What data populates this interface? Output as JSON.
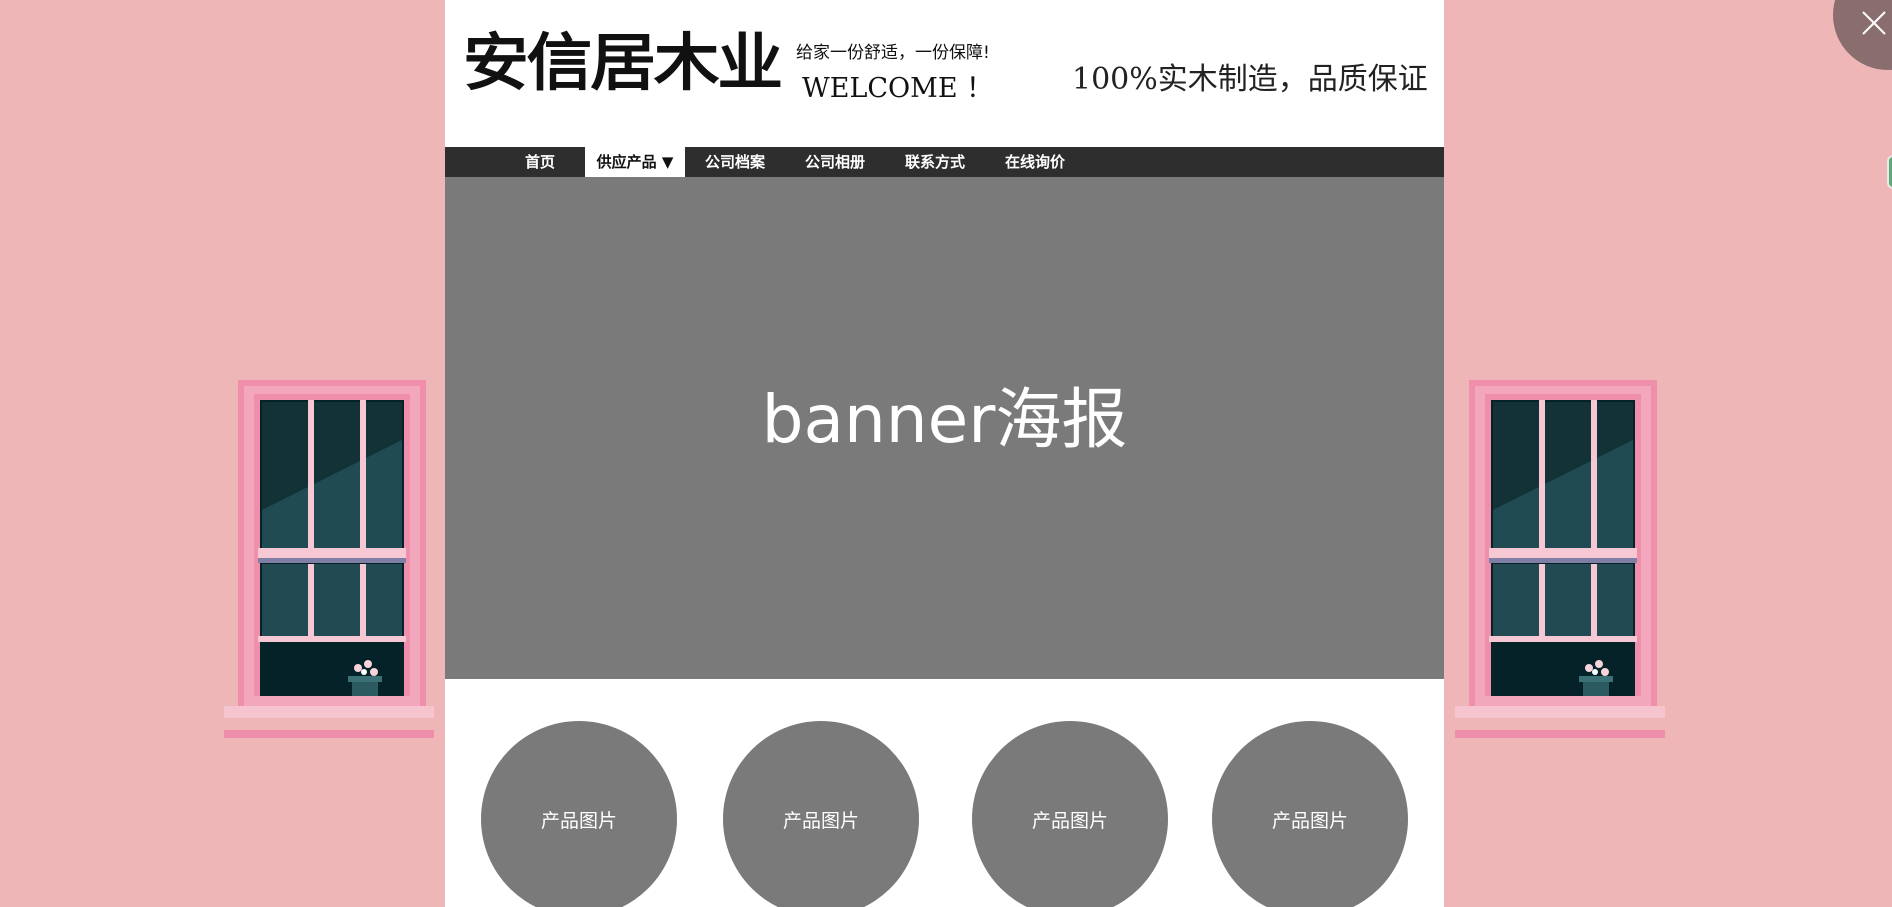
{
  "header": {
    "logo": "安信居木业",
    "slogan": "给家一份舒适，一份保障!",
    "welcome": "WELCOME ！",
    "quality": "100%实木制造，品质保证"
  },
  "nav": {
    "items": [
      {
        "label": "首页"
      },
      {
        "label": "供应产品 ▼",
        "active": true
      },
      {
        "label": "公司档案"
      },
      {
        "label": "公司相册"
      },
      {
        "label": "联系方式"
      },
      {
        "label": "在线询价"
      }
    ]
  },
  "banner": {
    "text": "banner海报"
  },
  "products": [
    {
      "label": "产品图片"
    },
    {
      "label": "产品图片"
    },
    {
      "label": "产品图片"
    },
    {
      "label": "产品图片"
    }
  ],
  "colors": {
    "background": "#eeb6b7",
    "nav_bg": "#2e2e2e",
    "placeholder_gray": "#7a7a7a",
    "window_frame": "#ef8fab",
    "window_glass": "#062229"
  },
  "icons": {
    "close": "close-icon",
    "windows": "window-illustration"
  }
}
